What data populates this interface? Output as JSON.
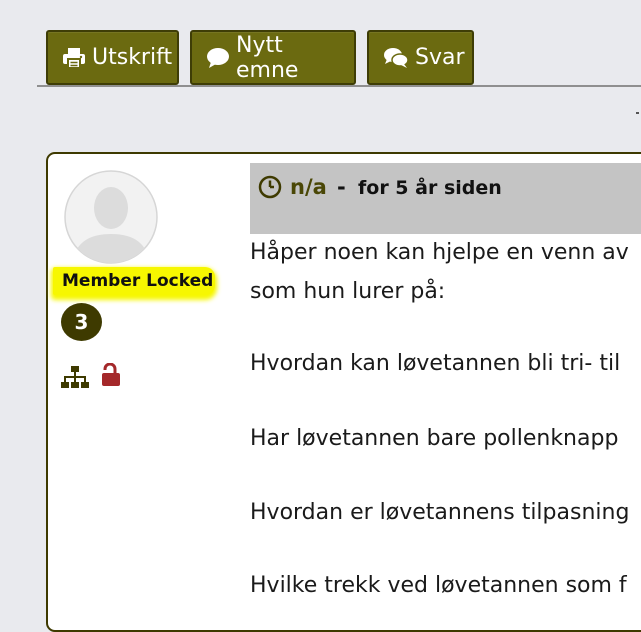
{
  "toolbar": {
    "print_label": "Utskrift",
    "new_topic_label": "Nytt emne",
    "reply_label": "Svar"
  },
  "author": {
    "status": "Member Locked",
    "post_count": "3"
  },
  "post": {
    "author_name": "n/a",
    "separator": "-",
    "time": "for 5 år siden",
    "body": [
      "Håper noen kan hjelpe en venn av",
      "som hun lurer på:",
      "Hvordan kan løvetannen bli tri- til",
      "Har løvetannen bare pollenknapp",
      "Hvordan er løvetannens tilpasning",
      "Hvilke trekk ved løvetannen som f"
    ]
  },
  "colors": {
    "button_bg": "#6b6a10",
    "highlight": "#f7f700",
    "badge": "#3e3a00",
    "unlock_icon": "#a4282a",
    "author_color": "#4a4706"
  },
  "icons": [
    "print-icon",
    "comment-icon",
    "comments-icon",
    "avatar-placeholder",
    "sitemap-icon",
    "unlock-icon",
    "clock-icon"
  ]
}
